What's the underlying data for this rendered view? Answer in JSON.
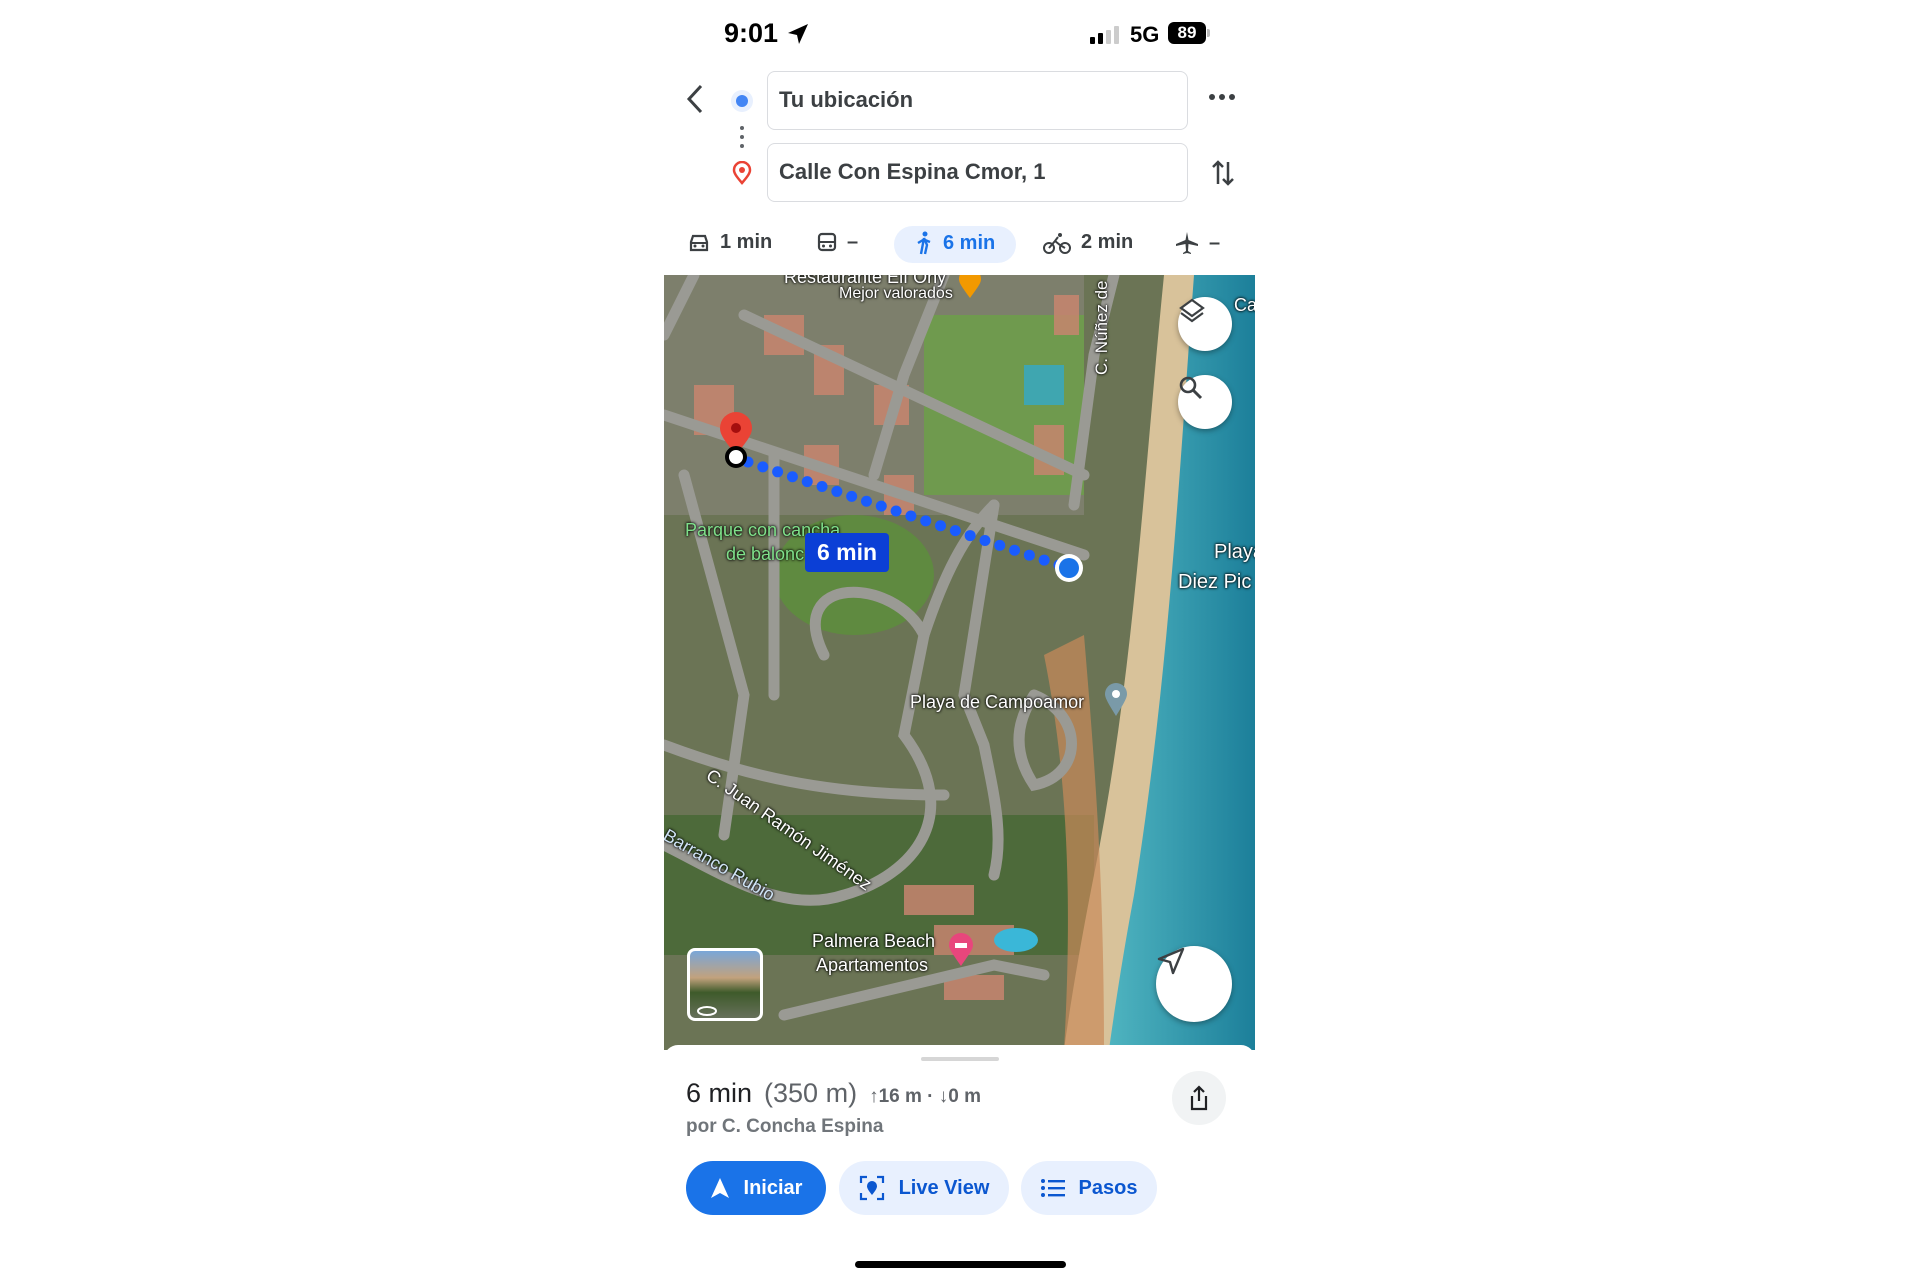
{
  "status_bar": {
    "time": "9:01",
    "network": "5G",
    "battery": "89"
  },
  "directions": {
    "origin": "Tu ubicación",
    "destination": "Calle Con Espina Cmor, 1"
  },
  "modes": [
    {
      "name": "car",
      "label": "1 min"
    },
    {
      "name": "transit",
      "label": "–"
    },
    {
      "name": "walk",
      "label": "6 min",
      "selected": true
    },
    {
      "name": "bike",
      "label": "2 min"
    },
    {
      "name": "flight",
      "label": "–"
    }
  ],
  "map": {
    "labels": {
      "restaurant": "Restaurante Elf Ony",
      "restaurant_sub": "Mejor valorados",
      "street_nunez": "C. Núñez de",
      "park": "Parque con cancha",
      "park_2": "de balonc",
      "playa": "Playa",
      "playa_2": "Diez Pic",
      "campoamor": "Playa de Campoamor",
      "juan_ramon": "C. Juan Ramón Jiménez",
      "barranco": "Barranco Rubio",
      "palmera": "Palmera Beach",
      "palmera_2": "Apartamentos",
      "top_right": "Cam"
    },
    "route_time": "6 min",
    "route_color": "#1a5cff"
  },
  "summary": {
    "duration": "6 min",
    "distance": "(350 m)",
    "elevation": "↑16 m · ↓0 m",
    "via": "por C. Concha Espina"
  },
  "actions": {
    "start": "Iniciar",
    "live_view": "Live View",
    "steps": "Pasos"
  },
  "colors": {
    "accent": "#1a73e8",
    "pill": "#e8f0fe",
    "dest_pin": "#ea4335"
  }
}
